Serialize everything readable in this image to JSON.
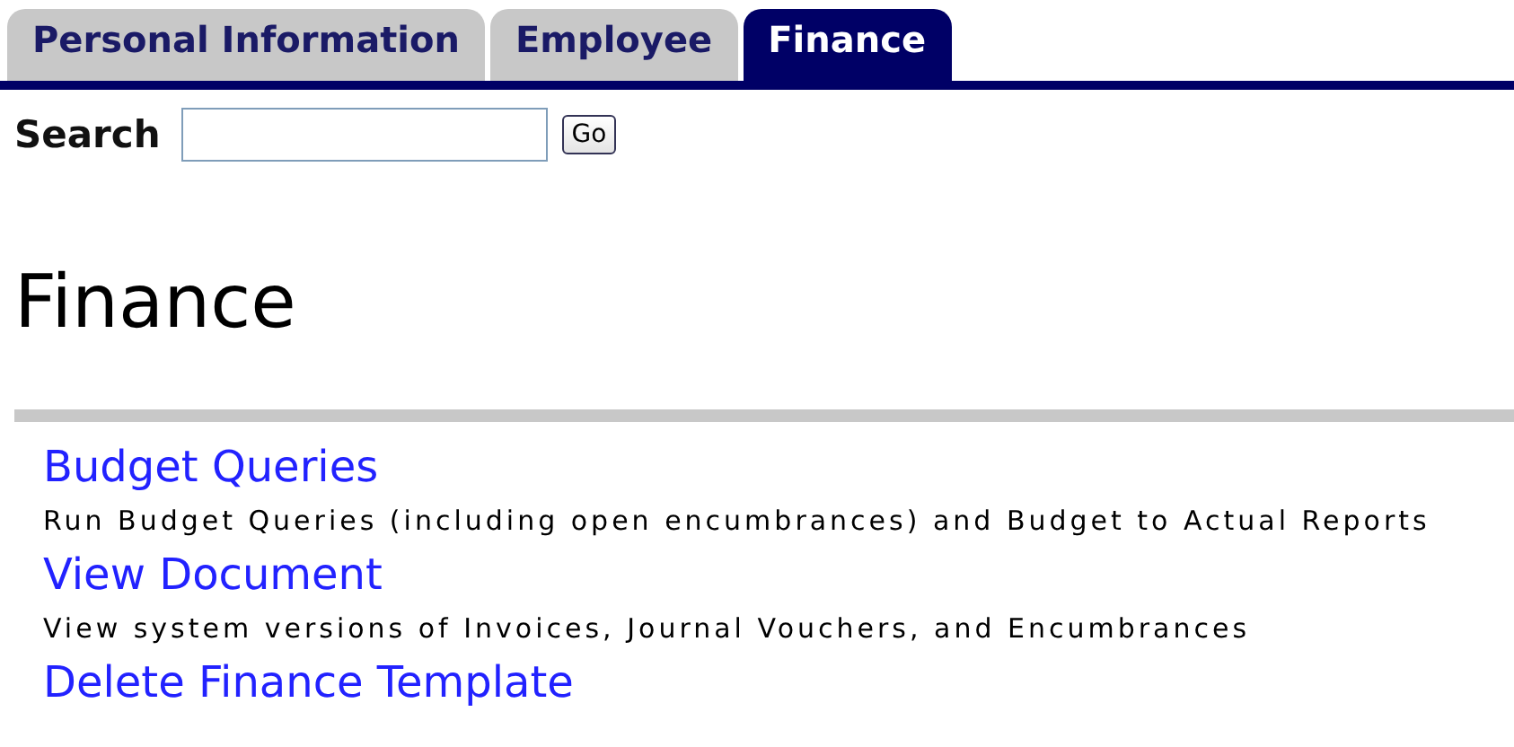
{
  "tabs": [
    {
      "label": "Personal Information",
      "selected": false
    },
    {
      "label": "Employee",
      "selected": false
    },
    {
      "label": "Finance",
      "selected": true
    }
  ],
  "search": {
    "label": "Search",
    "button": "Go"
  },
  "heading": "Finance",
  "links": [
    {
      "title": "Budget Queries",
      "description": "Run Budget Queries (including open encumbrances) and Budget to Actual Reports"
    },
    {
      "title": "View Document",
      "description": "View system versions of Invoices, Journal Vouchers, and Encumbrances"
    },
    {
      "title": "Delete Finance Template"
    }
  ]
}
